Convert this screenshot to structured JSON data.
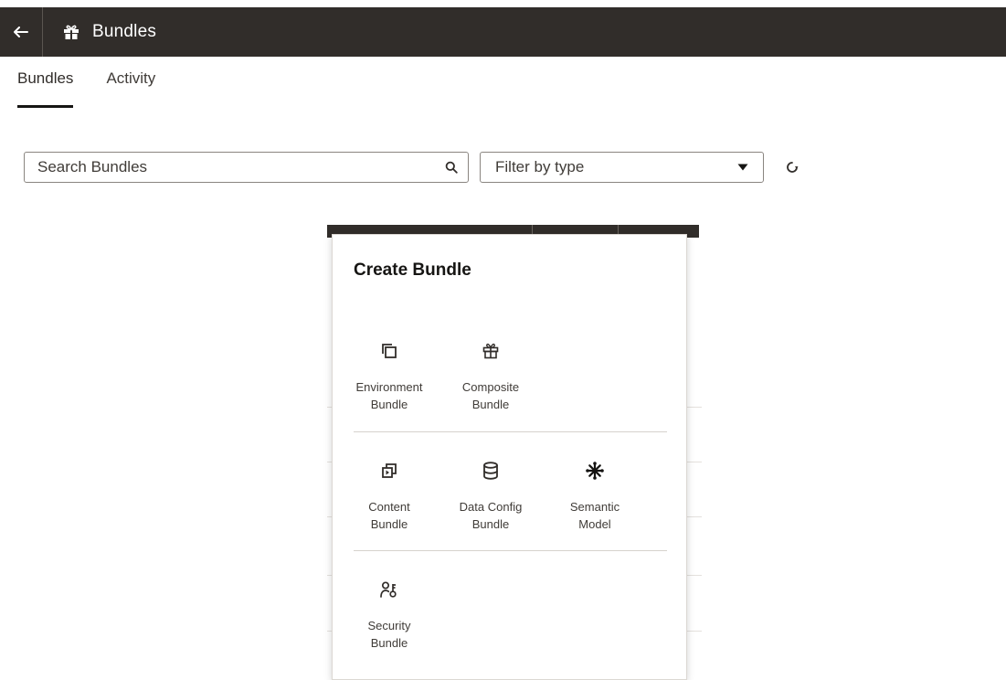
{
  "header": {
    "title": "Bundles",
    "back_icon": "back-arrow-icon",
    "title_icon": "gift-icon"
  },
  "tabs": [
    {
      "label": "Bundles",
      "active": true
    },
    {
      "label": "Activity",
      "active": false
    }
  ],
  "toolbar": {
    "search_placeholder": "Search Bundles",
    "search_value": "",
    "filter_label": "Filter by type",
    "refresh_icon": "refresh-icon"
  },
  "popup": {
    "title": "Create Bundle",
    "groups": [
      [
        {
          "icon": "copy-icon",
          "label": "Environment\nBundle"
        },
        {
          "icon": "gift-icon",
          "label": "Composite\nBundle"
        }
      ],
      [
        {
          "icon": "content-icon",
          "label": "Content\nBundle"
        },
        {
          "icon": "database-icon",
          "label": "Data Config\nBundle"
        },
        {
          "icon": "snowflake-icon",
          "label": "Semantic\nModel"
        }
      ],
      [
        {
          "icon": "user-key-icon",
          "label": "Security\nBundle"
        }
      ]
    ]
  },
  "colors": {
    "header_bg": "#312d2a",
    "text": "#161513",
    "muted_text": "#403c38",
    "border": "#8a8580"
  }
}
